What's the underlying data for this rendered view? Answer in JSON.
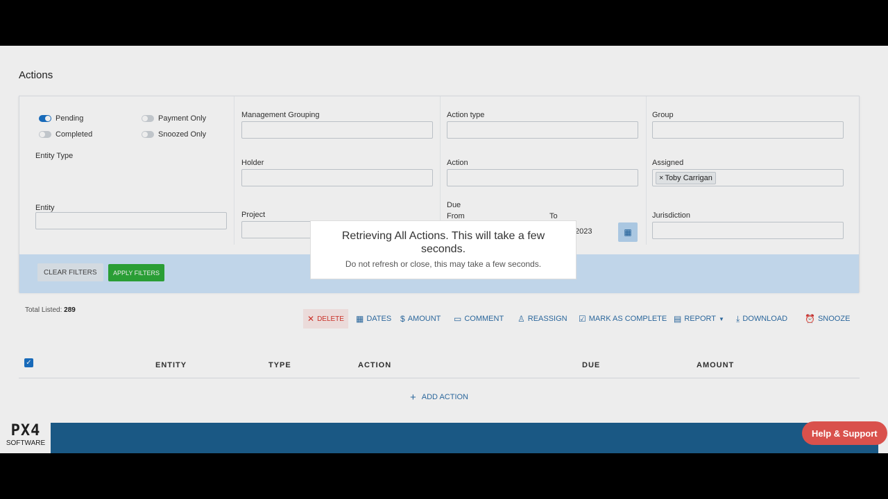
{
  "page": {
    "title": "Actions"
  },
  "filters": {
    "toggles": [
      {
        "label": "Pending",
        "on": true
      },
      {
        "label": "Completed",
        "on": false
      },
      {
        "label": "Payment Only",
        "on": false
      },
      {
        "label": "Snoozed Only",
        "on": false
      }
    ],
    "entity_type": {
      "label": "Entity Type",
      "value": ""
    },
    "entity": {
      "label": "Entity",
      "value": ""
    },
    "management_grouping": {
      "label": "Management Grouping",
      "value": ""
    },
    "holder": {
      "label": "Holder",
      "value": ""
    },
    "project": {
      "label": "Project",
      "value": ""
    },
    "action_type": {
      "label": "Action type",
      "value": ""
    },
    "action": {
      "label": "Action",
      "value": ""
    },
    "due": {
      "label": "Due",
      "from_label": "From",
      "to_label": "To",
      "to_value": "N 2023"
    },
    "group": {
      "label": "Group",
      "value": ""
    },
    "assigned": {
      "label": "Assigned",
      "chip": "Toby Carrigan",
      "chip_remove": "×"
    },
    "jurisdiction": {
      "label": "Jurisdiction",
      "value": ""
    },
    "clear_label": "CLEAR FILTERS",
    "apply_label": "APPLY FILTERS"
  },
  "summary": {
    "total_label": "Total Listed:",
    "total_value": "289"
  },
  "toolbar": {
    "delete": "DELETE",
    "dates": "DATES",
    "amount": "AMOUNT",
    "comment": "COMMENT",
    "reassign": "REASSIGN",
    "mark_complete": "MARK AS COMPLETE",
    "report": "REPORT",
    "download": "DOWNLOAD",
    "snooze": "SNOOZE"
  },
  "table": {
    "columns": [
      "ENTITY",
      "TYPE",
      "ACTION",
      "DUE",
      "AMOUNT"
    ],
    "add_label": "ADD ACTION"
  },
  "modal": {
    "title": "Retrieving All Actions. This will take a few seconds.",
    "subtitle": "Do not refresh or close, this may take a few seconds."
  },
  "logo": {
    "mark": "PX4",
    "sub": "SOFTWARE"
  },
  "help": {
    "label": "Help & Support"
  },
  "colors": {
    "primary": "#1a73c8",
    "apply": "#2eaa3a",
    "footer": "#1d5f8e",
    "help": "#d9514c",
    "delete": "#d9342b"
  }
}
